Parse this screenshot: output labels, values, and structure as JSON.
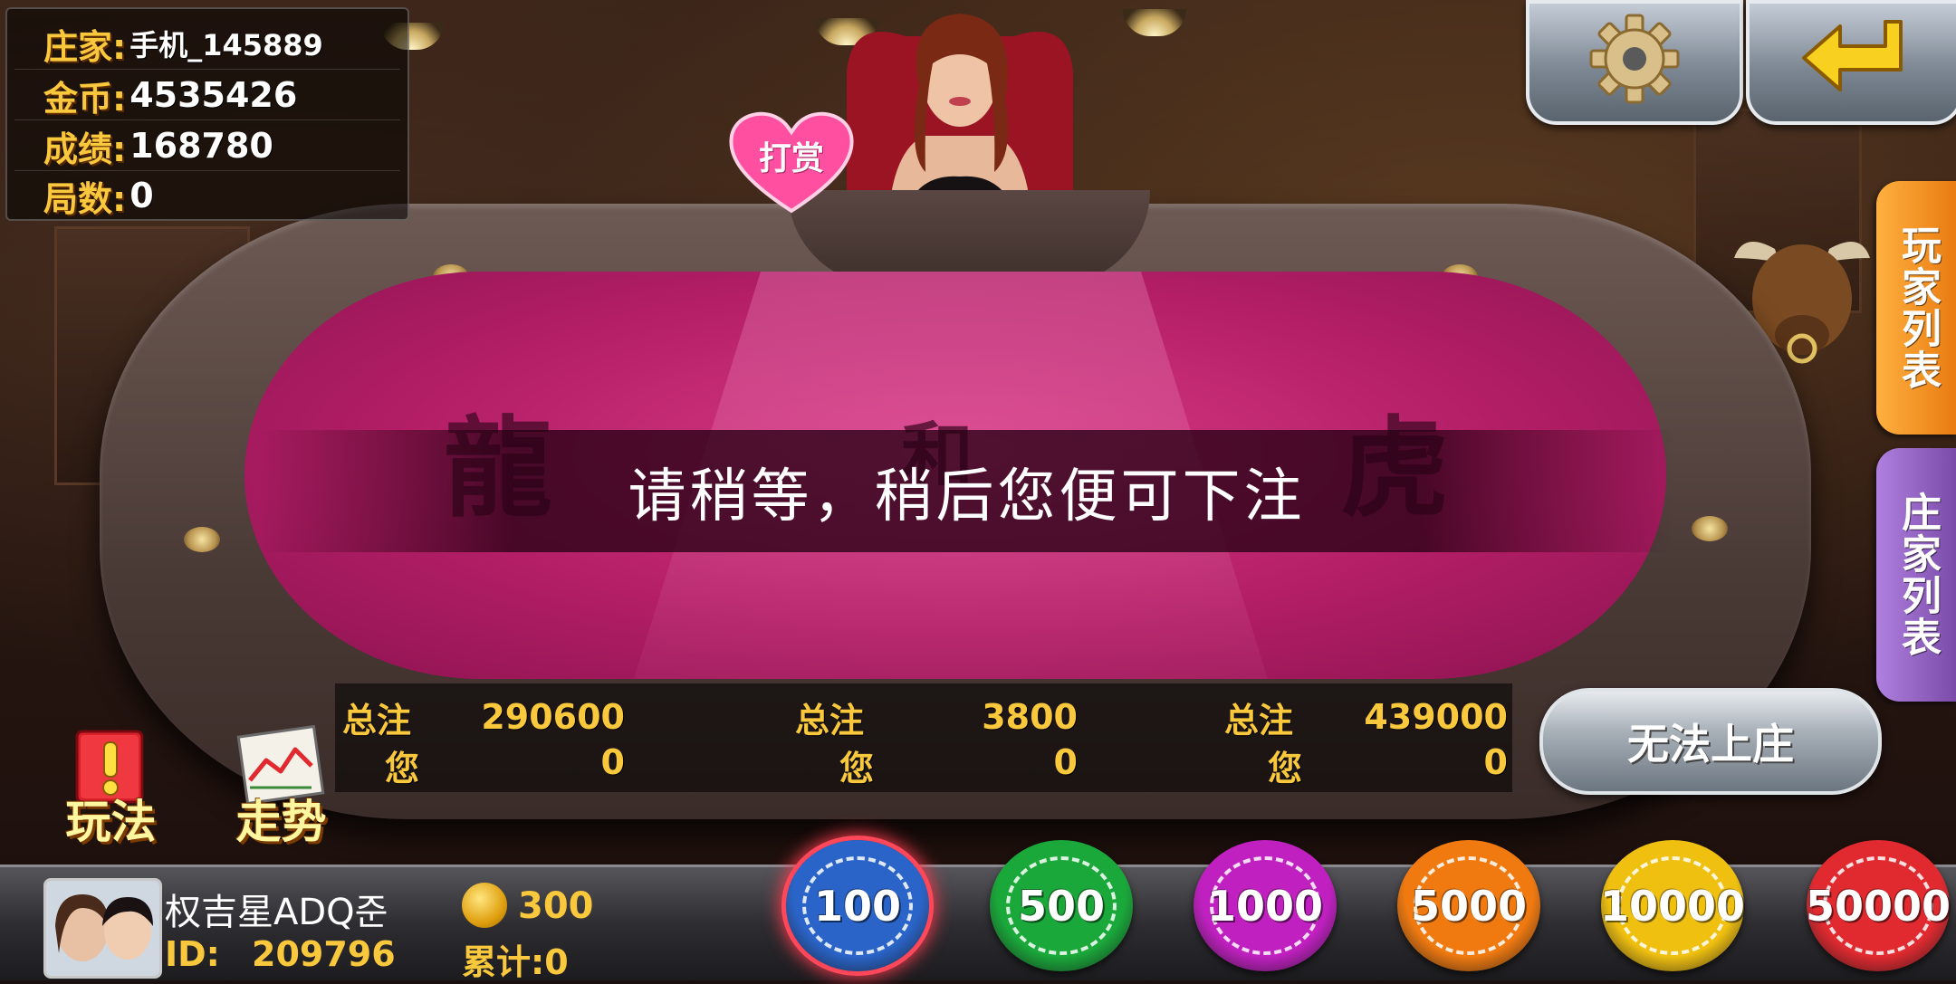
{
  "info": {
    "banker_label": "庄家:",
    "banker_value": "手机_145889",
    "gold_label": "金币:",
    "gold_value": "4535426",
    "score_label": "成绩:",
    "score_value": "168780",
    "rounds_label": "局数:",
    "rounds_value": "0"
  },
  "top_buttons": {
    "settings_icon": "gear-icon",
    "back_icon": "return-arrow-icon"
  },
  "reward_button": "打赏",
  "table": {
    "zones": [
      "龍",
      "和",
      "虎"
    ],
    "wait_message": "请稍等，稍后您便可下注"
  },
  "bets": [
    {
      "total_label": "总注",
      "total_value": "290600",
      "you_label": "您",
      "you_value": "0"
    },
    {
      "total_label": "总注",
      "total_value": "3800",
      "you_label": "您",
      "you_value": "0"
    },
    {
      "total_label": "总注",
      "total_value": "439000",
      "you_label": "您",
      "you_value": "0"
    }
  ],
  "side_tabs": {
    "player_list": "玩家列表",
    "banker_list": "庄家列表"
  },
  "banker_button": "无法上庄",
  "tools": {
    "rules": "玩法",
    "trend": "走势"
  },
  "player": {
    "name": "权吉星ADQ준",
    "id_label": "ID:",
    "id_value": "209796",
    "coins": "300",
    "total_label": "累计:0"
  },
  "chips": [
    {
      "value": "100",
      "color": "#2a64c8",
      "selected": true
    },
    {
      "value": "500",
      "color": "#1aa83a",
      "selected": false
    },
    {
      "value": "1000",
      "color": "#c020c0",
      "selected": false
    },
    {
      "value": "5000",
      "color": "#f07a10",
      "selected": false
    },
    {
      "value": "10000",
      "color": "#f0c010",
      "selected": false
    },
    {
      "value": "50000",
      "color": "#e02a30",
      "selected": false
    }
  ]
}
